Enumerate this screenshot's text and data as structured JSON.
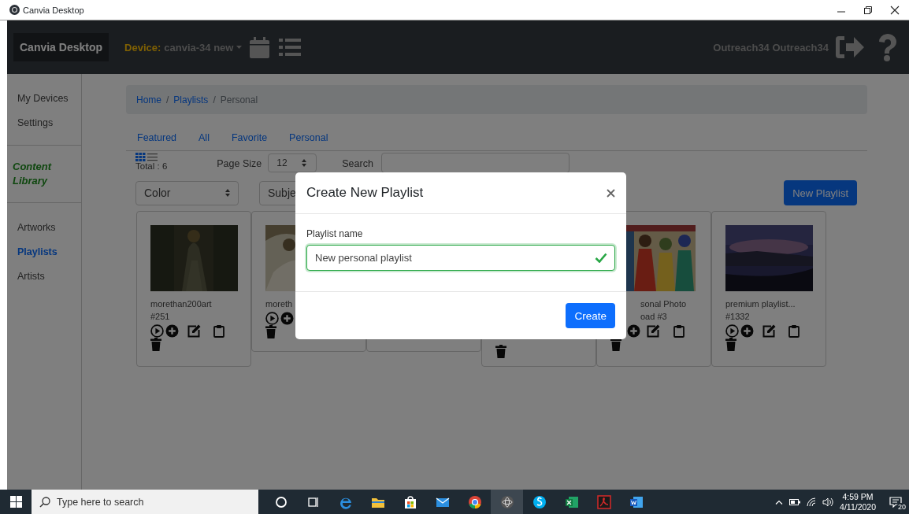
{
  "window": {
    "title": "Canvia Desktop"
  },
  "navbar": {
    "brand": "Canvia Desktop",
    "device_label": "Device:",
    "device": "canvia-34 new",
    "user": "Outreach34 Outreach34"
  },
  "sidebar": {
    "top_items": [
      {
        "label": "My Devices",
        "selected": false
      },
      {
        "label": "Settings",
        "selected": false
      }
    ],
    "section": "Content Library",
    "items": [
      {
        "label": "Artworks",
        "selected": false
      },
      {
        "label": "Playlists",
        "selected": true
      },
      {
        "label": "Artists",
        "selected": false
      }
    ]
  },
  "breadcrumb": {
    "separator": "/",
    "items": [
      {
        "label": "Home",
        "link": true
      },
      {
        "label": "Playlists",
        "link": true
      },
      {
        "label": "Personal",
        "link": false
      }
    ]
  },
  "tabs": [
    "Featured",
    "All",
    "Favorite",
    "Personal"
  ],
  "toolbar": {
    "views": [
      {
        "kind": "grid",
        "selected": true
      },
      {
        "kind": "list",
        "selected": false
      }
    ],
    "total": "Total : 6",
    "page_size_label": "Page Size",
    "page_size": "12",
    "search_label": "Search"
  },
  "filters": [
    "Color",
    "Subje"
  ],
  "new_button": "New Playlist",
  "cards": [
    {
      "kind": "full",
      "title": "morethan200art",
      "number": "#251"
    },
    {
      "kind": "right-cut",
      "title": "moreth"
    },
    {
      "kind": "hidden"
    },
    {
      "kind": "trash-only"
    },
    {
      "kind": "left-cut",
      "title": "sonal Photo",
      "number": "oad #3"
    },
    {
      "kind": "full",
      "title": "premium playlist...",
      "number": "#1332"
    }
  ],
  "modal": {
    "title": "Create New Playlist",
    "field_label": "Playlist name",
    "value": "New personal playlist",
    "valid": true,
    "button": "Create"
  },
  "taskbar": {
    "search_placeholder": "Type here to search",
    "time": "4:59 PM",
    "date": "4/11/2020",
    "notifications": "20"
  }
}
